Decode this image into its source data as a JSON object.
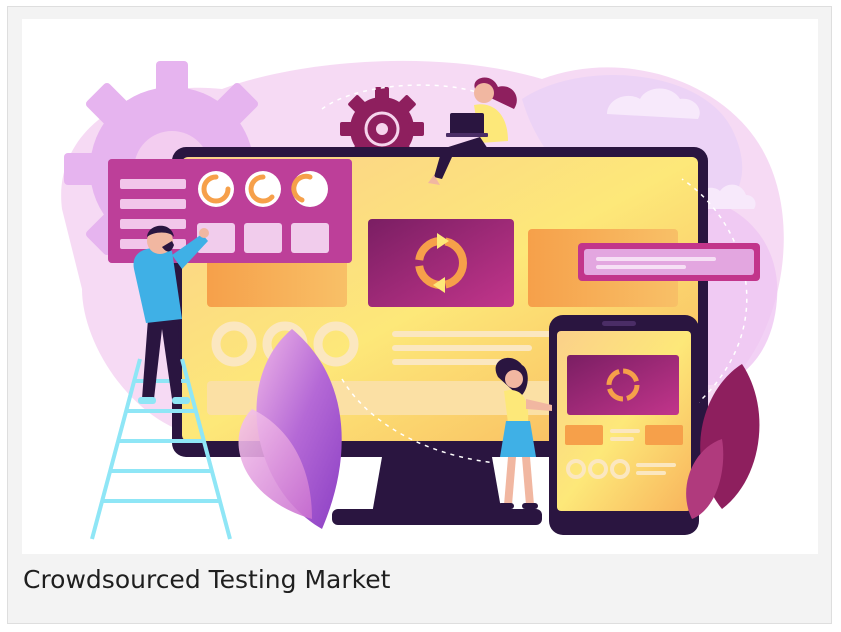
{
  "card": {
    "caption": "Crowdsourced Testing Market"
  },
  "illustration": {
    "subject": "crowdsourced testing illustration",
    "colors": {
      "purple_dark": "#3d1858",
      "magenta": "#c2358b",
      "pink_light": "#f1c4e6",
      "orange": "#f6a04a",
      "yellow": "#fde879",
      "violet": "#8b3fc4",
      "lavender": "#e8ccf4",
      "cyan": "#7fe1f4"
    }
  }
}
